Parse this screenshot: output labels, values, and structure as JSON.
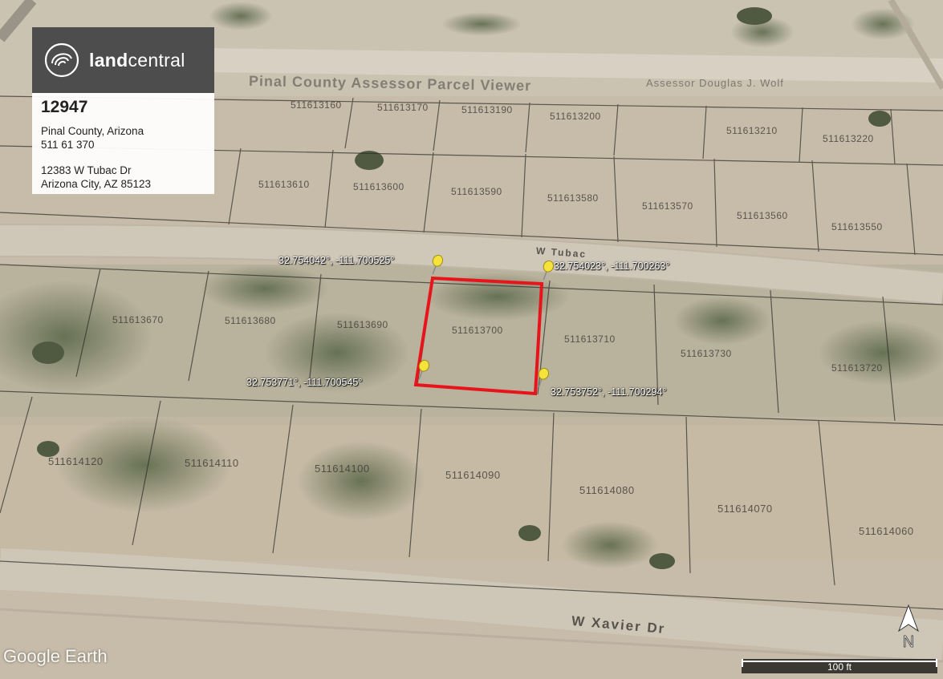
{
  "brand": {
    "name_bold": "land",
    "name_light": "central"
  },
  "property": {
    "id": "12947",
    "county": "Pinal County, Arizona",
    "apn": "511 61 370",
    "address_line1": "12383 W Tubac Dr",
    "address_line2": "Arizona City, AZ 85123"
  },
  "parcel_viewer": {
    "title": "Pinal County Assessor Parcel Viewer",
    "assessor": "Assessor Douglas J. Wolf"
  },
  "corners": [
    {
      "label": "32.754042°, -111.700525°"
    },
    {
      "label": "32.754023°, -111.700263°"
    },
    {
      "label": "32.753771°, -111.700545°"
    },
    {
      "label": "32.753752°, -111.700294°"
    }
  ],
  "streets": {
    "north": "W Tubac",
    "south": "W Xavier Dr"
  },
  "parcel_labels": [
    "511613160",
    "511613170",
    "511613190",
    "511613200",
    "511613210",
    "511613220",
    "511613610",
    "511613600",
    "511613590",
    "511613580",
    "511613570",
    "511613560",
    "511613550",
    "511613670",
    "511613680",
    "511613690",
    "511613700",
    "511613710",
    "511613720",
    "511613730",
    "511614110",
    "511614100",
    "511614090",
    "511614080",
    "511614070",
    "511614060",
    "511614120"
  ],
  "map": {
    "logo": "Google Earth",
    "scale_label": "100 ft",
    "north_label": "N",
    "boundary_color": "#e8141c",
    "pin_color": "#f5e23a"
  }
}
